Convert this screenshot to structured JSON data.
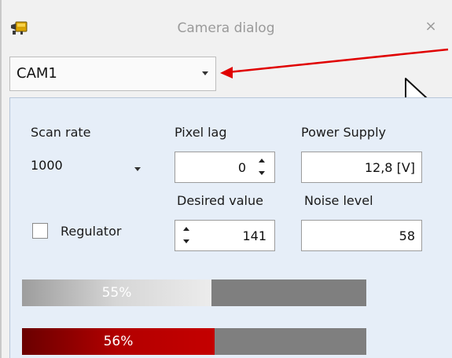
{
  "window": {
    "title": "Camera dialog",
    "close_glyph": "×",
    "app_icon": "camera-icon"
  },
  "camera_select": {
    "value": "CAM1",
    "arrow_icon": "chevron-down-icon"
  },
  "settings": {
    "scan_rate": {
      "label": "Scan rate",
      "value": "1000"
    },
    "pixel_lag": {
      "label": "Pixel lag",
      "value": "0"
    },
    "power_supply": {
      "label": "Power Supply",
      "value": "12,8 [V]"
    },
    "desired_value": {
      "label": "Desired value",
      "value": "141"
    },
    "noise_level": {
      "label": "Noise level",
      "value": "58"
    },
    "regulator": {
      "label": "Regulator",
      "checked": false
    }
  },
  "progress": [
    {
      "label": "55%",
      "value": 0.55,
      "fill_color": "#c9c9c9"
    },
    {
      "label": "56%",
      "value": 0.56,
      "fill_color": "#b00000"
    }
  ],
  "colors": {
    "panel_bg": "#e6eef8",
    "annotation_arrow": "#e00000",
    "bar_track": "#7f7f7f"
  }
}
